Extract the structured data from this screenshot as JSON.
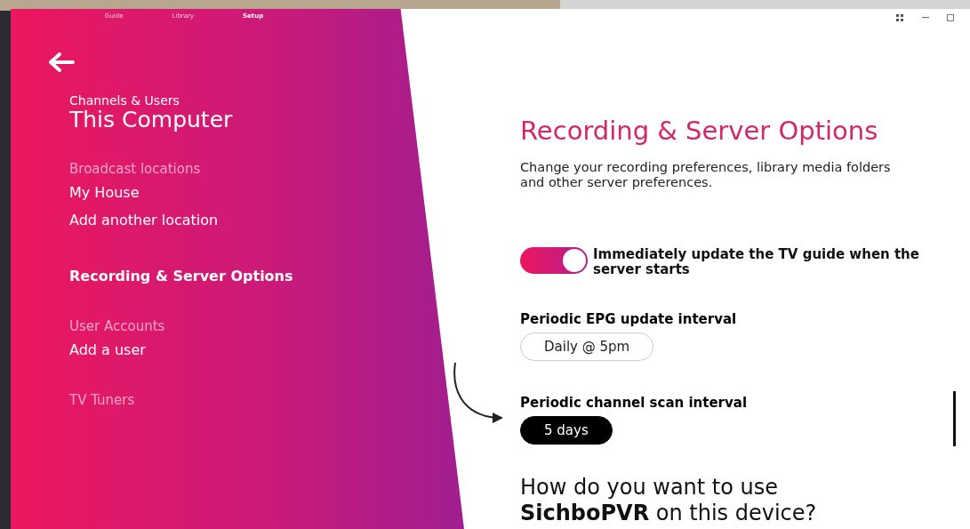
{
  "nav": [
    {
      "label": "Guide",
      "selected": false
    },
    {
      "label": "Library",
      "selected": false
    },
    {
      "label": "Setup",
      "selected": true
    }
  ],
  "sidebar": {
    "subtitle": "Channels & Users",
    "title": "This Computer",
    "sections": [
      {
        "heading": "Broadcast locations",
        "items": [
          {
            "label": "My House",
            "selected": false
          },
          {
            "label": "Add another location",
            "selected": false
          }
        ]
      },
      {
        "items": [
          {
            "label": "Recording & Server Options",
            "selected": true
          }
        ]
      },
      {
        "heading": "User Accounts",
        "items": [
          {
            "label": "Add a user",
            "selected": false
          }
        ]
      },
      {
        "heading": "TV Tuners"
      }
    ]
  },
  "main": {
    "title": "Recording & Server Options",
    "description": "Change your recording preferences, library media folders and other server preferences.",
    "toggle": {
      "label": "Immediately update the TV guide when the server starts",
      "on": true
    },
    "settings": [
      {
        "label": "Periodic EPG update interval",
        "value": "Daily @ 5pm",
        "focused": false
      },
      {
        "label": "Periodic channel scan interval",
        "value": "5 days",
        "focused": true
      }
    ],
    "question": "How do you want to use **SichboPVR** on this device?"
  }
}
